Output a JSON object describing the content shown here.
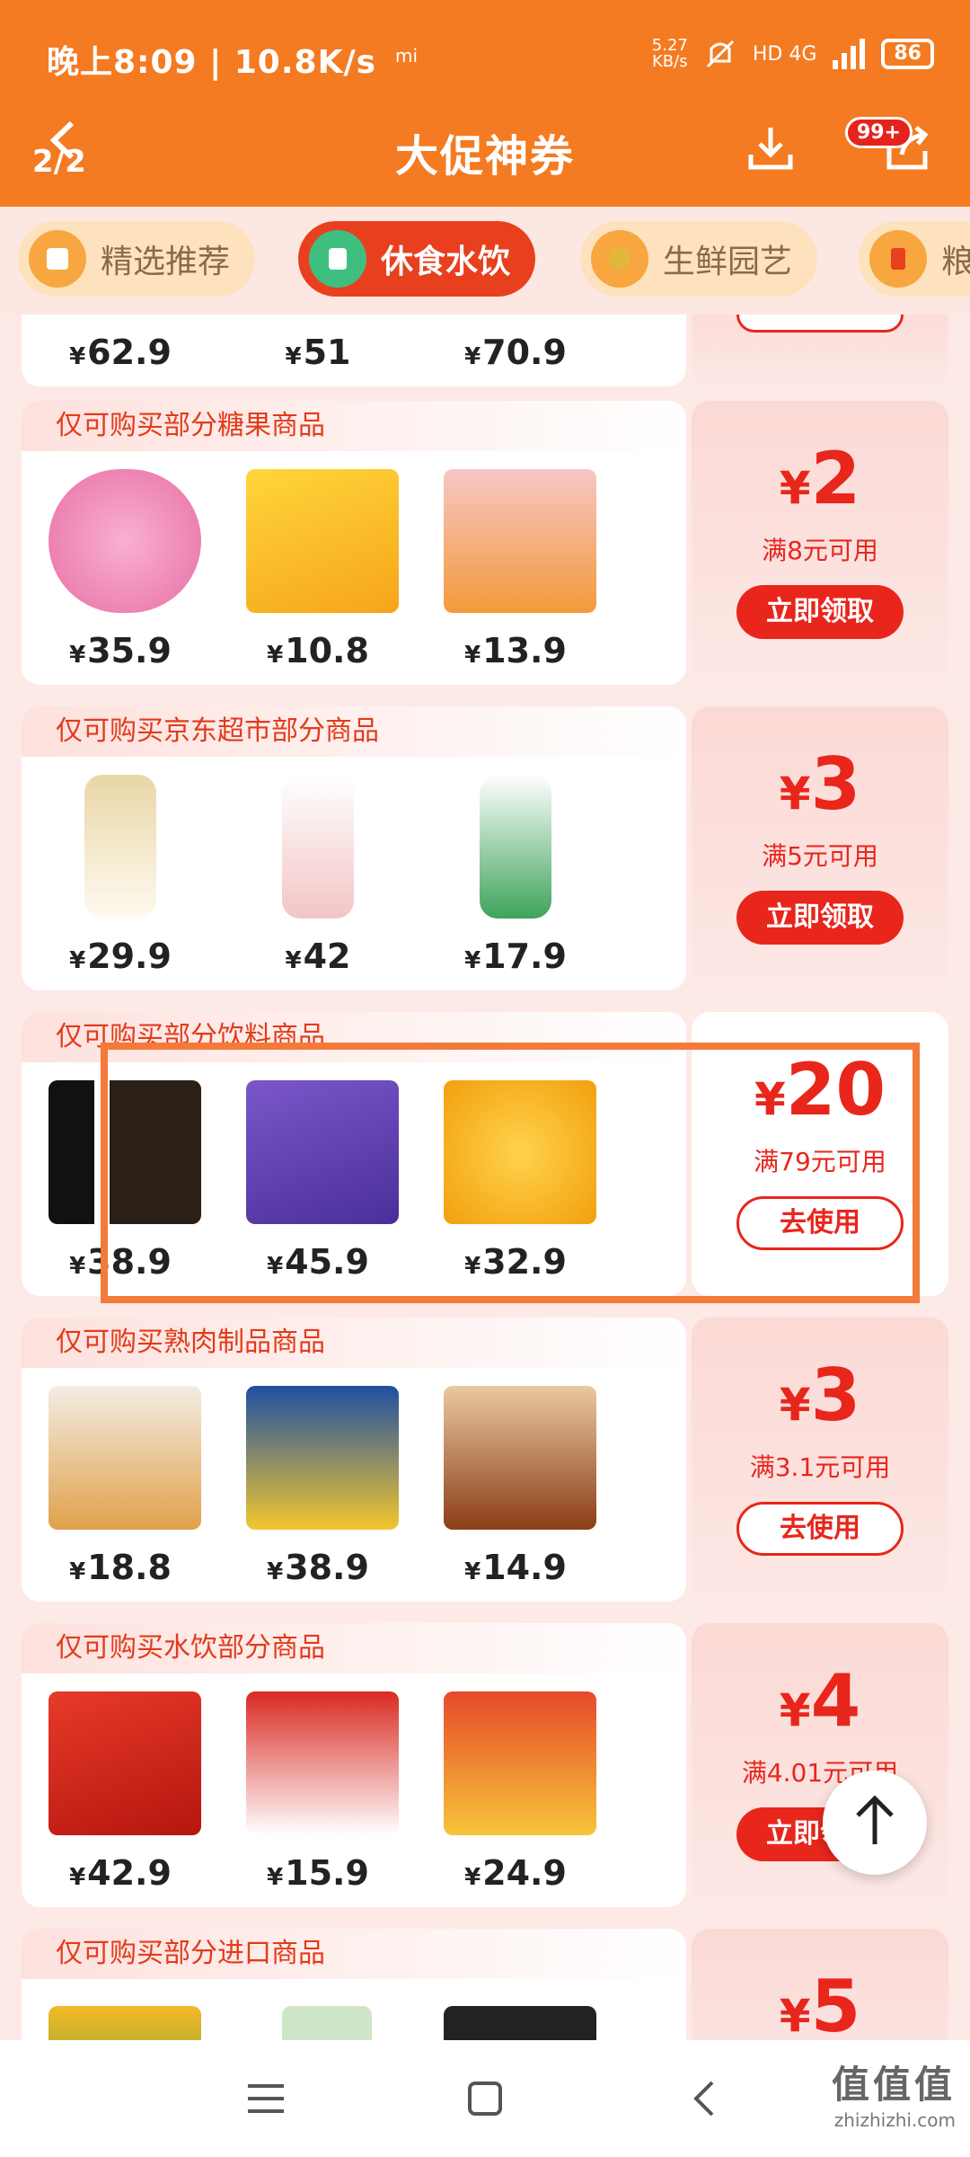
{
  "status": {
    "time_speed": "晚上8:09 | 10.8K/s",
    "netspeed_top": "5.27",
    "netspeed_unit": "KB/s",
    "signal": "HD 4G",
    "battery": "86"
  },
  "header": {
    "page_indicator": "2/2",
    "title": "大促神券",
    "badge": "99+"
  },
  "tabs": [
    {
      "label": "精选推荐",
      "active": false
    },
    {
      "label": "休食水饮",
      "active": true
    },
    {
      "label": "生鲜园艺",
      "active": false
    },
    {
      "label": "粮",
      "active": false
    }
  ],
  "cards": [
    {
      "head": "",
      "prices": [
        "62.9",
        "51",
        "70.9"
      ],
      "amount": "",
      "condition": "",
      "button": ""
    },
    {
      "head": "仅可购买部分糖果商品",
      "prices": [
        "35.9",
        "10.8",
        "13.9"
      ],
      "amount": "2",
      "condition": "满8元可用",
      "button": "立即领取",
      "button_style": "filled"
    },
    {
      "head": "仅可购买京东超市部分商品",
      "prices": [
        "29.9",
        "42",
        "17.9"
      ],
      "amount": "3",
      "condition": "满5元可用",
      "button": "立即领取",
      "button_style": "filled"
    },
    {
      "head": "仅可购买部分饮料商品",
      "prices": [
        "38.9",
        "45.9",
        "32.9"
      ],
      "amount": "20",
      "condition": "满79元可用",
      "button": "去使用",
      "button_style": "outline"
    },
    {
      "head": "仅可购买熟肉制品商品",
      "prices": [
        "18.8",
        "38.9",
        "14.9"
      ],
      "amount": "3",
      "condition": "满3.1元可用",
      "button": "去使用",
      "button_style": "outline"
    },
    {
      "head": "仅可购买水饮部分商品",
      "prices": [
        "42.9",
        "15.9",
        "24.9"
      ],
      "amount": "4",
      "condition": "满4.01元可用",
      "button": "立即领取",
      "button_style": "filled"
    },
    {
      "head": "仅可购买部分进口商品",
      "prices": [
        "",
        "",
        ""
      ],
      "amount": "5",
      "condition": "",
      "button": ""
    }
  ],
  "currency": "¥",
  "watermark": {
    "big": "值值值",
    "small": "zhizhizhi.com"
  },
  "colors": {
    "accent": "#f47b22",
    "coupon_red": "#e8261c"
  }
}
